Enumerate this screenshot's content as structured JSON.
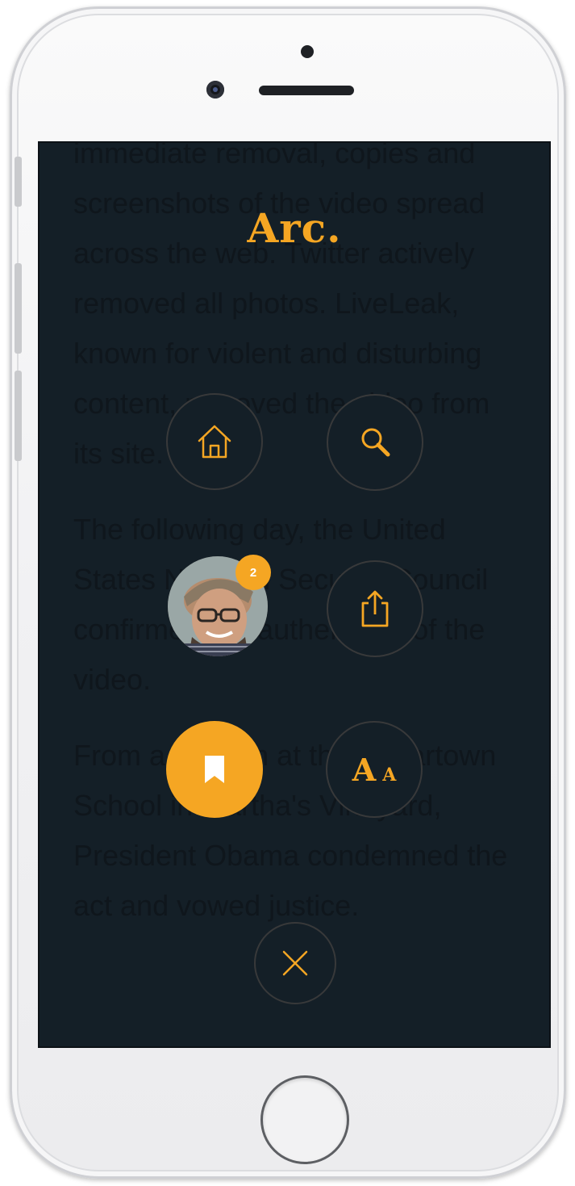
{
  "app": {
    "logo": "Arc."
  },
  "article_background": {
    "paragraphs": [
      "immediate removal, copies and screenshots of the video spread across the web. Twitter actively removed all photos. LiveLeak, known for violent and disturbing content, removed the video from its site.",
      "The following day, the United States National Security Council confirmed the authenticity of the video.",
      "From a podium at the Edgartown School in Martha's Vineyard, President Obama condemned the act and vowed justice."
    ]
  },
  "menu": {
    "items": [
      {
        "id": "home",
        "icon": "home-icon"
      },
      {
        "id": "search",
        "icon": "search-icon"
      },
      {
        "id": "profile",
        "icon": "avatar",
        "badge": "2"
      },
      {
        "id": "share",
        "icon": "share-icon"
      },
      {
        "id": "bookmark",
        "icon": "bookmark-icon",
        "active": true
      },
      {
        "id": "font-size",
        "icon": "font-size-icon",
        "big_letter": "A",
        "small_letter": "A"
      },
      {
        "id": "close",
        "icon": "close-icon"
      }
    ]
  },
  "colors": {
    "accent": "#f5a623",
    "screen_background": "#141f27",
    "circle_border": "#38393a"
  }
}
